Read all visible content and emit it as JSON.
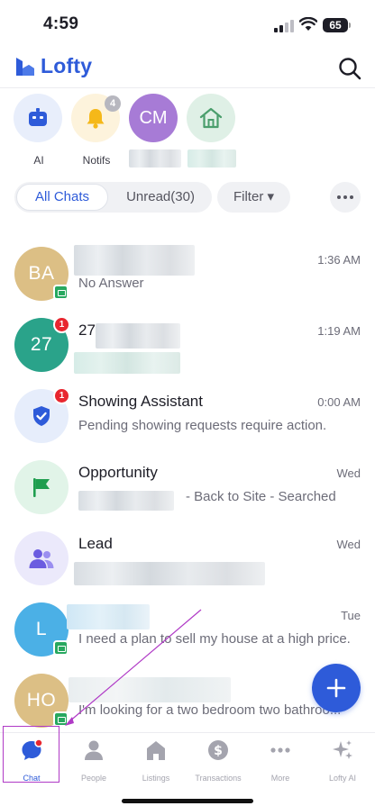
{
  "status_bar": {
    "time": "4:59",
    "battery": "65"
  },
  "brand": {
    "name": "Lofty"
  },
  "quick": [
    {
      "key": "ai",
      "label": "AI",
      "badge": ""
    },
    {
      "key": "notifs",
      "label": "Notifs",
      "badge": "4"
    },
    {
      "key": "cm",
      "initials": "CM",
      "label": ""
    },
    {
      "key": "home",
      "label": ""
    }
  ],
  "filters": {
    "all": "All Chats",
    "unread": "Unread(30)",
    "filter": "Filter ▾"
  },
  "chats": [
    {
      "initials": "BA",
      "name": "",
      "time": "1:36 AM",
      "preview": "No Answer"
    },
    {
      "initials": "27",
      "name": "27",
      "time": "1:19 AM",
      "preview": "",
      "badge": "1"
    },
    {
      "name": "Showing Assistant",
      "time": "0:00 AM",
      "preview": "Pending showing requests require action.",
      "badge": "1"
    },
    {
      "name": "Opportunity",
      "time": "Wed",
      "preview": "- Back to Site - Searched"
    },
    {
      "name": "Lead",
      "time": "Wed",
      "preview": ""
    },
    {
      "initials": "L",
      "name": "",
      "time": "Tue",
      "preview": "I need a plan to sell my house at a high price."
    },
    {
      "initials": "HO",
      "name": "",
      "time": "",
      "preview": "I'm looking for a two bedroom two bathroo..."
    }
  ],
  "tabs": [
    {
      "label": "Chat"
    },
    {
      "label": "People"
    },
    {
      "label": "Listings"
    },
    {
      "label": "Transactions"
    },
    {
      "label": "More"
    },
    {
      "label": "Lofty AI"
    }
  ],
  "colors": {
    "brand": "#2e5bd9",
    "avatar_ba": "#dcbf85",
    "avatar_27": "#2aa38a",
    "avatar_cm": "#a77bd6",
    "avatar_l": "#4bb0e6",
    "avatar_ho": "#dcbf85",
    "unread_badge": "#e8262f",
    "channel_badge": "#27a85f",
    "annotation": "#b03ac6"
  }
}
